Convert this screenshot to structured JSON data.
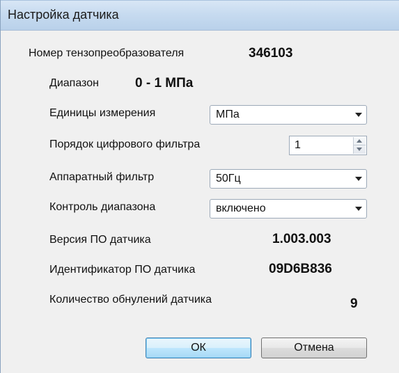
{
  "window": {
    "title": "Настройка датчика"
  },
  "sensor": {
    "number_label": "Номер тензопреобразователя",
    "number_value": "346103",
    "range_label": "Диапазон",
    "range_value": "0 - 1 МПа"
  },
  "settings": {
    "units_label": "Единицы измерения",
    "units_value": "МПа",
    "filter_order_label": "Порядок цифрового фильтра",
    "filter_order_value": "1",
    "hw_filter_label": "Аппаратный фильтр",
    "hw_filter_value": "50Гц",
    "range_control_label": "Контроль диапазона",
    "range_control_value": "включено"
  },
  "info": {
    "fw_version_label": "Версия ПО датчика",
    "fw_version_value": "1.003.003",
    "fw_id_label": "Идентификатор ПО датчика",
    "fw_id_value": "09D6B836",
    "zero_count_label": "Количество обнулений датчика",
    "zero_count_value": "9"
  },
  "buttons": {
    "ok_label": "ОК",
    "cancel_label": "Отмена"
  },
  "icons": {
    "dropdown": "chevron-down-icon",
    "spin_up": "spin-up-icon",
    "spin_down": "spin-down-icon"
  }
}
